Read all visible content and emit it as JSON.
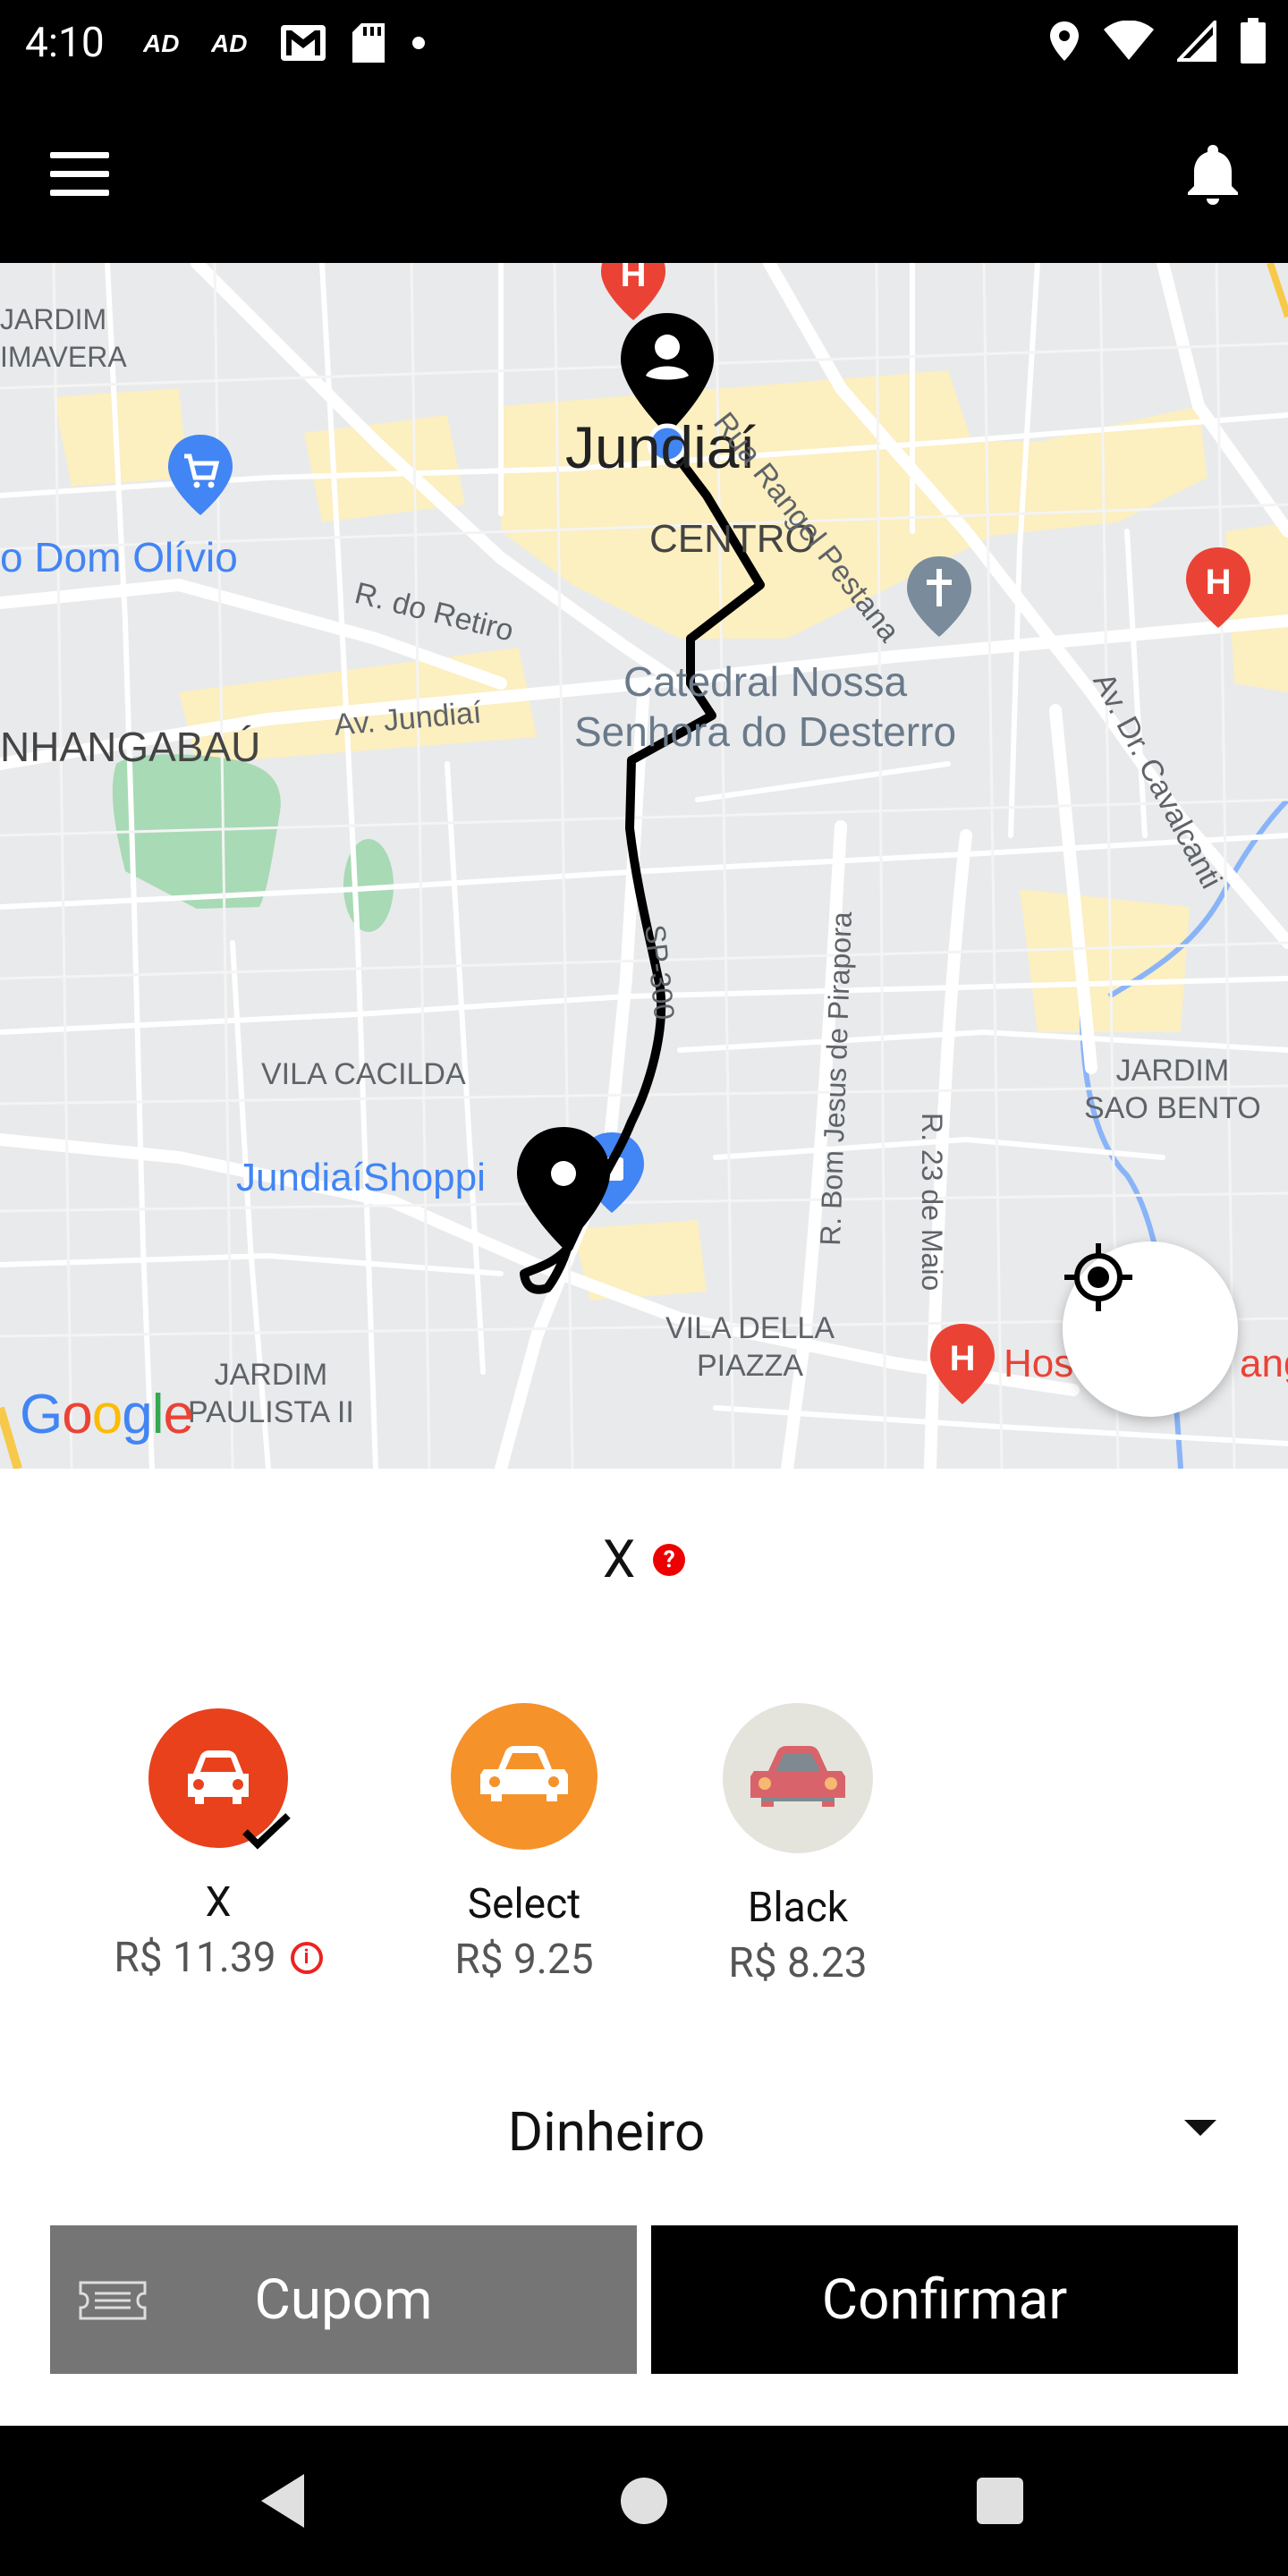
{
  "status_bar": {
    "time": "4:10",
    "icons_left": [
      "ad-icon",
      "ad-icon",
      "gmail-icon",
      "sd-card-icon",
      "dot-icon"
    ],
    "icons_right": [
      "location-icon",
      "wifi-icon",
      "signal-icon",
      "battery-icon"
    ]
  },
  "app_bar": {
    "menu_icon": "hamburger-menu-icon",
    "bell_icon": "notification-bell-icon"
  },
  "map": {
    "labels": {
      "jardim_primavera": "JARDIM\nIMAVERA",
      "jundiai": "Jundiaí",
      "centro": "CENTRO",
      "rua_rangel_pestana": "Rua Rangel Pestana",
      "dom_olivio": "o Dom Olívio",
      "r_do_retiro": "R. do Retiro",
      "catedral": "Catedral Nossa\nSenhora do Desterro",
      "anhangabau": "NHANGABAÚ",
      "av_jundiai": "Av. Jundiaí",
      "av_dr_cavalcanti": "Av. Dr. Cavalcanti",
      "r_bom_jesus": "R. Bom Jesus de Pirapora",
      "sp_300": "SP-300",
      "vila_cacilda": "VILA CACILDA",
      "jardim_sao_bento": "JARDIM\nSAO BENTO",
      "jundiai_shopping": "JundiaíShoppi",
      "r_23_de_maio": "R. 23 de Maio",
      "vila_della_piazza": "VILA DELLA\nPIAZZA",
      "jardim_paulista": "JARDIM\nPAULISTA II",
      "hospital": "Hos",
      "hospital_2": "ang"
    },
    "google_logo": [
      "G",
      "o",
      "o",
      "g",
      "l",
      "e"
    ],
    "colors": {
      "route": "#000000",
      "park": "#a8dab5",
      "highlight_area": "#fcefc0",
      "water": "#8ab4f8",
      "road": "#ffffff",
      "poi_blue": "#4285f4",
      "poi_red": "#ea4335"
    },
    "locate_icon": "my-location-crosshair-icon"
  },
  "ride_selection": {
    "selected_category": "X",
    "help_icon": "?",
    "options": [
      {
        "name": "X",
        "price": "R$ 11.39",
        "color": "#e8411c",
        "selected": true,
        "has_info": true
      },
      {
        "name": "Select",
        "price": "R$ 9.25",
        "color": "#f5922a",
        "selected": false,
        "has_info": false
      },
      {
        "name": "Black",
        "price": "R$ 8.23",
        "color": "#e4e4dc",
        "selected": false,
        "has_info": false
      }
    ],
    "info_icon_glyph": "i"
  },
  "payment": {
    "method": "Dinheiro"
  },
  "actions": {
    "coupon_label": "Cupom",
    "confirm_label": "Confirmar"
  }
}
